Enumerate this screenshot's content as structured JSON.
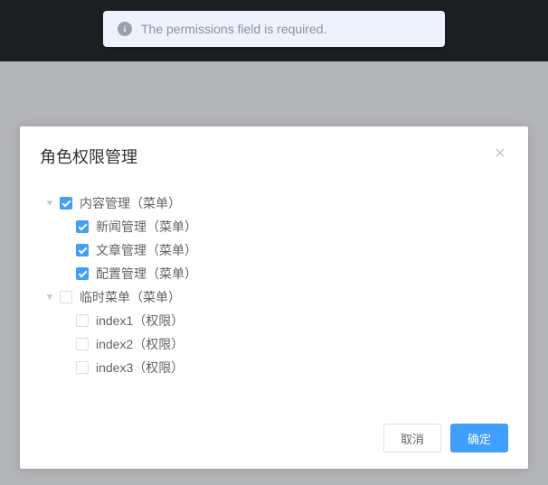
{
  "alert": {
    "message": "The permissions field is required."
  },
  "dialog": {
    "title": "角色权限管理",
    "tree": [
      {
        "label": "内容管理（菜单）",
        "checked": true,
        "expanded": true,
        "children": [
          {
            "label": "新闻管理（菜单）",
            "checked": true
          },
          {
            "label": "文章管理（菜单）",
            "checked": true
          },
          {
            "label": "配置管理（菜单）",
            "checked": true
          }
        ]
      },
      {
        "label": "临时菜单（菜单）",
        "checked": false,
        "expanded": true,
        "children": [
          {
            "label": "index1（权限）",
            "checked": false
          },
          {
            "label": "index2（权限）",
            "checked": false
          },
          {
            "label": "index3（权限）",
            "checked": false
          }
        ]
      }
    ],
    "footer": {
      "cancel": "取消",
      "confirm": "确定"
    }
  }
}
